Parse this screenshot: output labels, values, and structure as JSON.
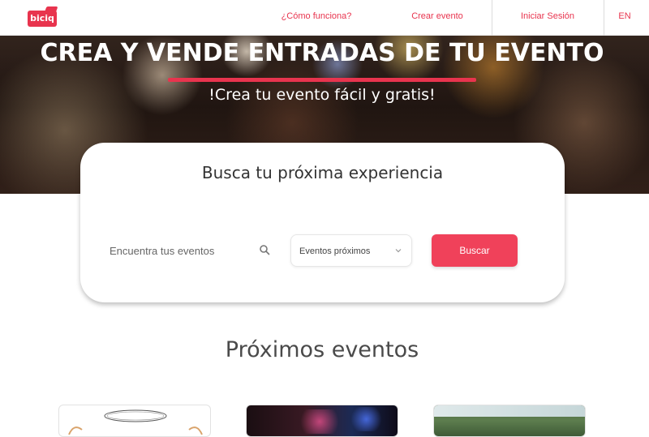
{
  "brand": {
    "logo_text": "biciq",
    "accent": "#e8344e"
  },
  "nav": {
    "how_it_works": "¿Cómo funciona?",
    "create_event": "Crear evento",
    "sign_in": "Iniciar Sesión",
    "language": "EN"
  },
  "hero": {
    "title": "CREA Y VENDE ENTRADAS DE TU EVENTO",
    "subtitle": "!Crea tu evento fácil y gratis!"
  },
  "search": {
    "title": "Busca tu próxima experiencia",
    "placeholder": "Encuentra tus eventos",
    "icon": "search-icon",
    "filter_selected": "Eventos próximos",
    "filter_icon": "chevron-down-icon",
    "button_label": "Buscar"
  },
  "upcoming": {
    "title": "Próximos eventos"
  }
}
